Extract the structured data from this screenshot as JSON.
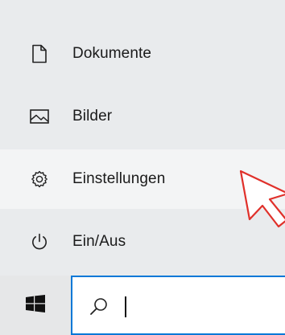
{
  "menu": {
    "items": [
      {
        "label": "Dokumente",
        "icon": "document-icon"
      },
      {
        "label": "Bilder",
        "icon": "pictures-icon"
      },
      {
        "label": "Einstellungen",
        "icon": "settings-gear-icon"
      },
      {
        "label": "Ein/Aus",
        "icon": "power-icon"
      }
    ]
  },
  "taskbar": {
    "start_icon": "windows-logo-icon",
    "search": {
      "icon": "search-icon",
      "value": "",
      "placeholder": ""
    }
  },
  "colors": {
    "menu_bg": "#e9ebed",
    "hover_bg": "#f3f4f5",
    "accent": "#0078d7",
    "cursor": "#e0302a"
  }
}
